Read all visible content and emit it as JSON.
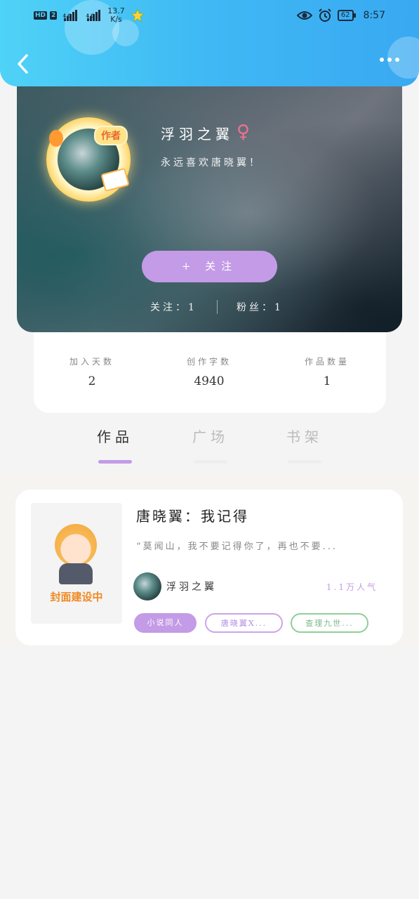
{
  "status_bar": {
    "hd": "HD",
    "sim": "2",
    "net1": "4G",
    "net2": "4G",
    "speed_value": "13.7",
    "speed_unit": "K/s",
    "battery": "62",
    "time": "8:57"
  },
  "profile": {
    "author_badge": "作者",
    "nickname": "浮羽之翼",
    "gender_symbol": "♀",
    "bio": "永远喜欢唐晓翼！",
    "follow_button": "+ 关注",
    "following_text": "关注：1",
    "fans_text": "粉丝：1"
  },
  "stats": [
    {
      "label": "加入天数",
      "value": "2"
    },
    {
      "label": "创作字数",
      "value": "4940"
    },
    {
      "label": "作品数量",
      "value": "1"
    }
  ],
  "tabs": [
    {
      "label": "作品",
      "active": true
    },
    {
      "label": "广场",
      "active": false
    },
    {
      "label": "书架",
      "active": false
    }
  ],
  "works": [
    {
      "cover_text": "封面建设中",
      "title": "唐晓翼：我记得",
      "excerpt": "“莫闻山，我不要记得你了，再也不要...",
      "author": "浮羽之翼",
      "popularity": "1.1万人气",
      "tags": [
        "小说同人",
        "唐晓翼X...",
        "查理九世..."
      ]
    }
  ],
  "colors": {
    "accent": "#c39be6",
    "header_start": "#4fd2f7",
    "header_end": "#39a9f2",
    "tag_green": "#8fcf97"
  }
}
